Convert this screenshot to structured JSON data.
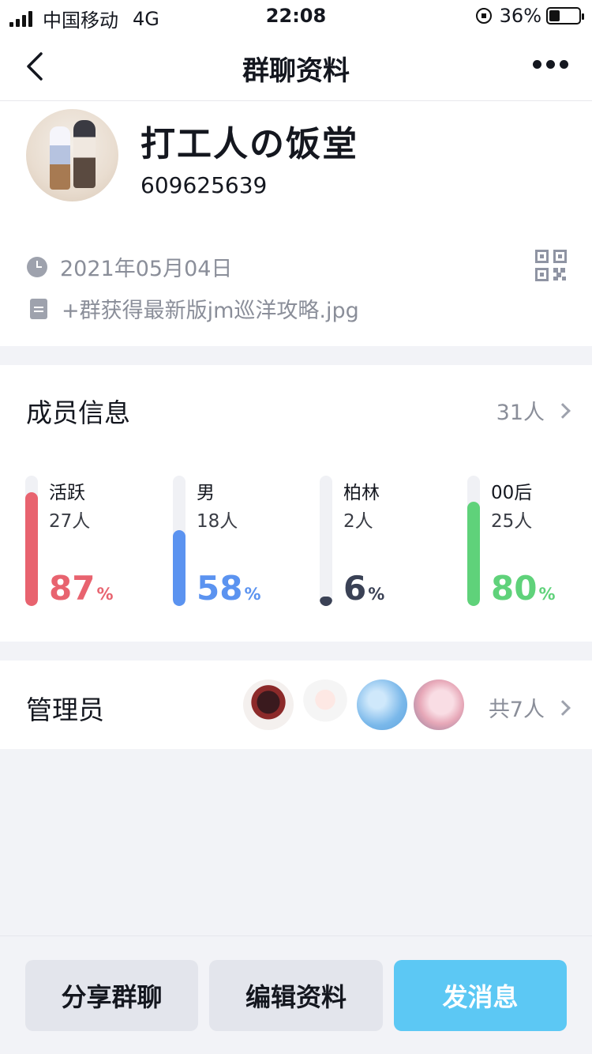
{
  "status_bar": {
    "carrier": "中国移动",
    "network": "4G",
    "time": "22:08",
    "battery": "36%",
    "battery_level": 0.36
  },
  "nav": {
    "title": "群聊资料",
    "back_icon": "back-chevron-icon",
    "more_icon": "more-dots-icon"
  },
  "group": {
    "name": "打工人の饭堂",
    "id": "609625639",
    "created_date": "2021年05月04日",
    "file_note": "+群获得最新版jm巡洋攻略.jpg"
  },
  "members": {
    "title": "成员信息",
    "total": "31人",
    "stats": [
      {
        "label": "活跃",
        "count": "27人",
        "percent": "87",
        "fraction": 0.87,
        "color": "#e8636f"
      },
      {
        "label": "男",
        "count": "18人",
        "percent": "58",
        "fraction": 0.58,
        "color": "#5b93f0"
      },
      {
        "label": "柏林",
        "count": "2人",
        "percent": "6",
        "fraction": 0.06,
        "color": "#3a4155"
      },
      {
        "label": "00后",
        "count": "25人",
        "percent": "80",
        "fraction": 0.8,
        "color": "#5fd27a"
      }
    ],
    "percent_sign": "%"
  },
  "admins": {
    "title": "管理员",
    "total": "共7人"
  },
  "actions": {
    "share": "分享群聊",
    "edit": "编辑资料",
    "message": "发消息"
  },
  "colors": {
    "accent_blue": "#5cc8f4",
    "background": "#f2f3f7",
    "muted_text": "#8a8e99"
  }
}
